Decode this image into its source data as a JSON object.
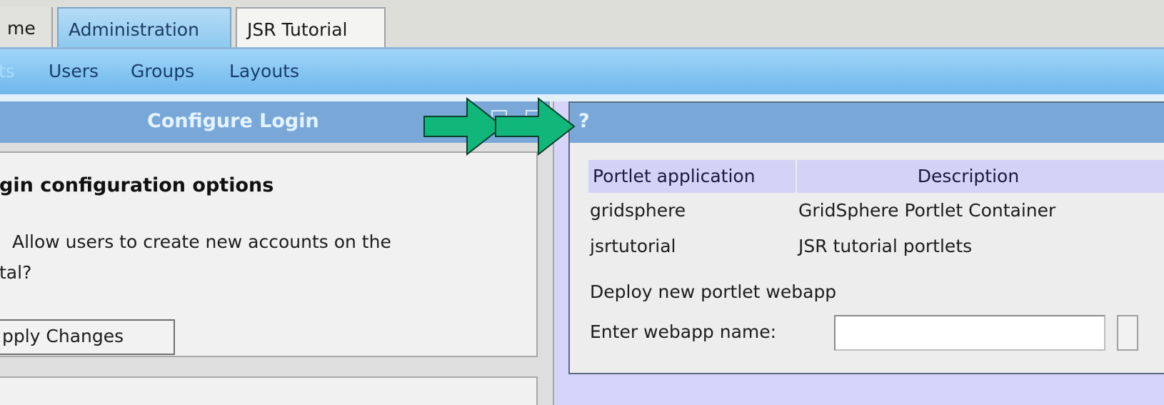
{
  "tabs": [
    {
      "label": "me",
      "active": false
    },
    {
      "label": "Administration",
      "active": true
    },
    {
      "label": "JSR Tutorial",
      "active": false
    }
  ],
  "subnav": {
    "items": [
      "ts",
      "Users",
      "Groups",
      "Layouts"
    ]
  },
  "login_portlet": {
    "title": "Configure Login",
    "heading": "gin configuration options",
    "option_line1": "Allow users to create new accounts on the",
    "option_line2": "tal?",
    "apply_label": "pply Changes"
  },
  "portlet_apps": {
    "title": "?",
    "columns": [
      "Portlet application",
      "Description"
    ],
    "rows": [
      [
        "gridsphere",
        "GridSphere Portlet Container"
      ],
      [
        "jsrtutorial",
        "JSR tutorial portlets"
      ]
    ],
    "deploy_label": "Deploy new portlet webapp",
    "webapp_label": "Enter webapp name:",
    "webapp_value": ""
  },
  "colors": {
    "background": "#d7d4fb",
    "titlebar": "#79a8d8",
    "arrow": "#11b77a",
    "header_cell": "#d4d2f7"
  }
}
